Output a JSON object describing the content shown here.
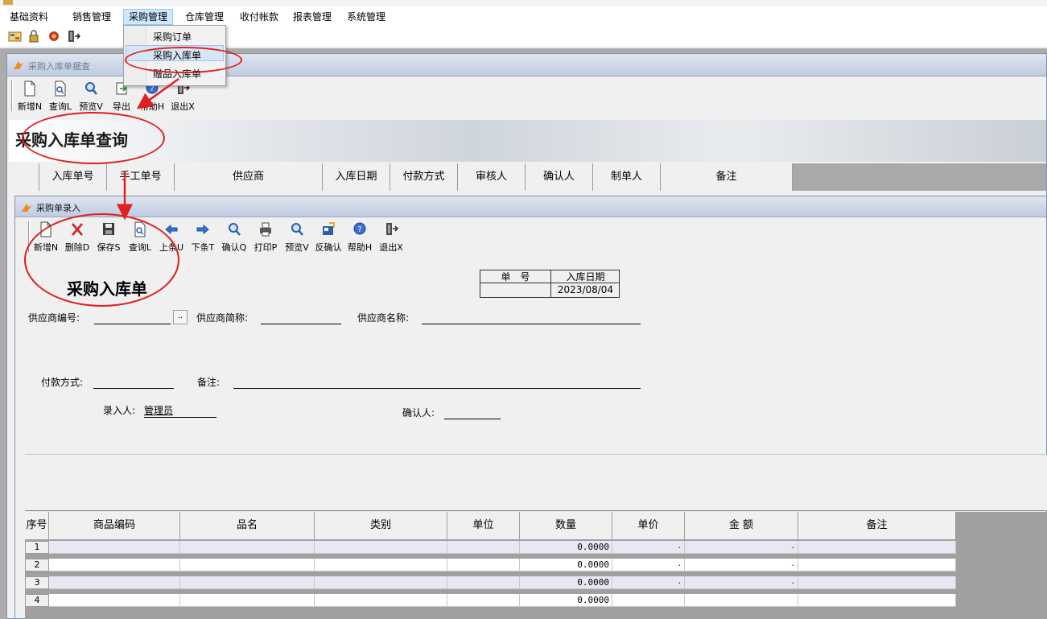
{
  "menubar": {
    "items": [
      "基础资料",
      "销售管理",
      "采购管理",
      "仓库管理",
      "收付帐款",
      "报表管理",
      "系统管理"
    ]
  },
  "dropdown": {
    "items": [
      "采购订单",
      "采购入库单",
      "赠品入库单"
    ]
  },
  "query_window": {
    "caption": "采购入库单据查",
    "toolbar": [
      {
        "label": "新增N",
        "icon": "new-doc-icon"
      },
      {
        "label": "查询L",
        "icon": "query-icon"
      },
      {
        "label": "预览V",
        "icon": "preview-icon"
      },
      {
        "label": "导出",
        "icon": "export-icon"
      },
      {
        "label": "帮助H",
        "icon": "help-icon"
      },
      {
        "label": "退出X",
        "icon": "exit-icon"
      }
    ],
    "banner_title": "采购入库单查询",
    "columns": [
      "入库单号",
      "手工单号",
      "供应商",
      "入库日期",
      "付款方式",
      "审核人",
      "确认人",
      "制单人",
      "备注"
    ]
  },
  "entry_window": {
    "caption": "采购单录入",
    "toolbar": [
      {
        "label": "新增N",
        "icon": "new-doc-icon"
      },
      {
        "label": "删除D",
        "icon": "delete-icon"
      },
      {
        "label": "保存S",
        "icon": "save-icon"
      },
      {
        "label": "查询L",
        "icon": "query-icon"
      },
      {
        "label": "上条U",
        "icon": "arrow-left-icon"
      },
      {
        "label": "下条T",
        "icon": "arrow-right-icon"
      },
      {
        "label": "确认Q",
        "icon": "confirm-icon"
      },
      {
        "label": "打印P",
        "icon": "print-icon"
      },
      {
        "label": "预览V",
        "icon": "preview-icon"
      },
      {
        "label": "反确认",
        "icon": "unconfirm-icon"
      },
      {
        "label": "帮助H",
        "icon": "help-icon"
      },
      {
        "label": "退出X",
        "icon": "exit-icon"
      }
    ],
    "title": "采购入库单",
    "header_table": {
      "doc_no_label": "单　号",
      "date_label": "入库日期",
      "doc_no": "",
      "date": "2023/08/04"
    },
    "fields": {
      "supplier_code_label": "供应商编号:",
      "supplier_short_label": "供应商简称:",
      "supplier_name_label": "供应商名称:",
      "browse_label": "..",
      "payment_label": "付款方式:",
      "remark_label": "备注:",
      "entered_by_label": "录入人:",
      "entered_by": "管理员",
      "confirmed_by_label": "确认人:"
    },
    "detail_columns": [
      "序号",
      "商品编码",
      "品名",
      "类别",
      "单位",
      "数量",
      "单价",
      "金 额",
      "备注"
    ],
    "detail_rows": [
      {
        "no": "1",
        "qty": "0.0000",
        "price": ".",
        "amount": "."
      },
      {
        "no": "2",
        "qty": "0.0000",
        "price": ".",
        "amount": "."
      },
      {
        "no": "3",
        "qty": "0.0000",
        "price": ".",
        "amount": "."
      },
      {
        "no": "4",
        "qty": "0.0000",
        "price": "",
        "amount": ""
      }
    ]
  },
  "colors": {
    "annotation": "#e02020",
    "menu_highlight": "#cce8ff",
    "row_alt": "#e8e8f4"
  }
}
